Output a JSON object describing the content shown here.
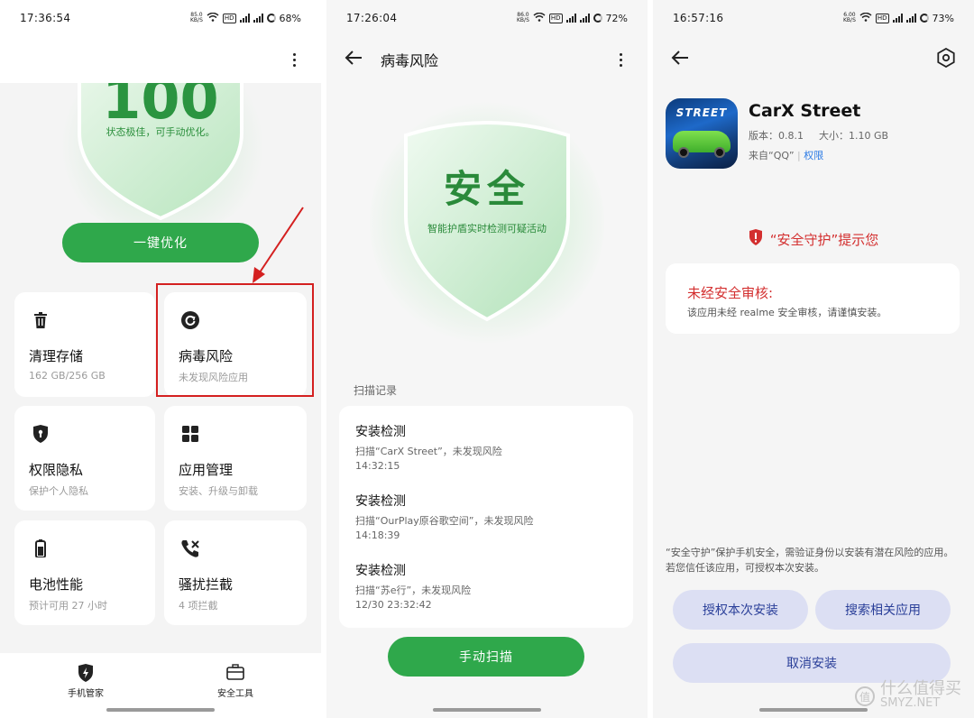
{
  "panel1": {
    "status": {
      "time": "17:36:54",
      "net_speed": "85.0",
      "net_unit": "KB/S",
      "battery": "68%"
    },
    "score": "100",
    "status_text": "状态极佳，可手动优化。",
    "optimize_button": "一键优化",
    "cards": [
      {
        "title": "清理存储",
        "sub": "162 GB/256 GB",
        "icon": "trash-icon"
      },
      {
        "title": "病毒风险",
        "sub": "未发现风险应用",
        "icon": "virus-scan-icon"
      },
      {
        "title": "权限隐私",
        "sub": "保护个人隐私",
        "icon": "privacy-shield-icon"
      },
      {
        "title": "应用管理",
        "sub": "安装、升级与卸载",
        "icon": "apps-grid-icon"
      },
      {
        "title": "电池性能",
        "sub": "预计可用 27 小时",
        "icon": "battery-icon"
      },
      {
        "title": "骚扰拦截",
        "sub": "4 项拦截",
        "icon": "call-block-icon"
      }
    ],
    "nav": [
      {
        "label": "手机管家",
        "icon": "shield-bolt-icon"
      },
      {
        "label": "安全工具",
        "icon": "toolbox-icon"
      }
    ],
    "annotation_color": "#d42020"
  },
  "panel2": {
    "status": {
      "time": "17:26:04",
      "net_speed": "86.0",
      "net_unit": "KB/S",
      "battery": "72%"
    },
    "title": "病毒风险",
    "hero_text": "安全",
    "hero_sub": "智能护盾实时检测可疑活动",
    "records_header": "扫描记录",
    "records": [
      {
        "title": "安装检测",
        "desc": "扫描“CarX Street”，未发现风险",
        "time": "14:32:15"
      },
      {
        "title": "安装检测",
        "desc": "扫描“OurPlay原谷歌空间”，未发现风险",
        "time": "14:18:39"
      },
      {
        "title": "安装检测",
        "desc": "扫描“苏e行”，未发现风险",
        "time": "12/30 23:32:42"
      }
    ],
    "scan_button": "手动扫描",
    "accent": "#2fa84b"
  },
  "panel3": {
    "status": {
      "time": "16:57:16",
      "net_speed": "6.00",
      "net_unit": "KB/S",
      "battery": "73%"
    },
    "app_icon_text": "STREET",
    "app_name": "CarX Street",
    "version": "版本：0.8.1",
    "size": "大小：1.10 GB",
    "source": "来自“QQ”",
    "permission_link": "权限",
    "warning_title": "“安全守护”提示您",
    "card_title": "未经安全审核:",
    "card_desc": "该应用未经 realme 安全审核，请谨慎安装。",
    "footnote": "“安全守护”保护手机安全，需验证身份以安装有潜在风险的应用。若您信任该应用，可授权本次安装。",
    "btn_authorize": "授权本次安装",
    "btn_search": "搜索相关应用",
    "btn_cancel": "取消安装",
    "warning_color": "#d32f2f"
  },
  "watermark": {
    "text": "什么值得买",
    "sub": "SMYZ.NET"
  }
}
